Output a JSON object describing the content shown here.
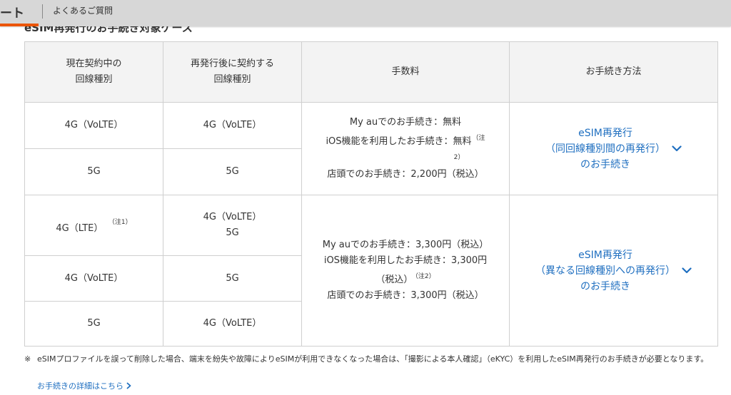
{
  "header": {
    "brand_fragment": "ート",
    "faq_link": "よくあるご質問"
  },
  "section_title": "eSIM再発行のお手続き対象ケース",
  "table": {
    "headers": {
      "current_line": [
        "現在契約中の",
        "回線種別"
      ],
      "after_line": [
        "再発行後に契約する",
        "回線種別"
      ],
      "fee": "手数料",
      "procedure": "お手続き方法"
    },
    "group1": {
      "rows": [
        {
          "current": "4G（VoLTE）",
          "after": "4G（VoLTE）"
        },
        {
          "current": "5G",
          "after": "5G"
        }
      ],
      "fee": {
        "line1": "My auでのお手続き：無料",
        "line2": "iOS機能を利用したお手続き：無料",
        "line2_note_a": "（注",
        "line2_note_b": "2）",
        "line3": "店頭でのお手続き：2,200円（税込）"
      },
      "procedure": {
        "line1": "eSIM再発行",
        "line2": "（同回線種別間の再発行）",
        "line3": "のお手続き"
      }
    },
    "group2": {
      "rows": [
        {
          "current": "4G（LTE）",
          "current_note": "（注1）",
          "after_line1": "4G（VoLTE）",
          "after_line2": "5G"
        },
        {
          "current": "4G（VoLTE）",
          "after": "5G"
        },
        {
          "current": "5G",
          "after": "4G（VoLTE）"
        }
      ],
      "fee": {
        "line1": "My auでのお手続き：3,300円（税込）",
        "line2": "iOS機能を利用したお手続き：3,300円",
        "line3": "（税込）",
        "line3_note": "（注2）",
        "line4": "店頭でのお手続き：3,300円（税込）"
      },
      "procedure": {
        "line1": "eSIM再発行",
        "line2": "（異なる回線種別への再発行）",
        "line3": "のお手続き"
      }
    }
  },
  "note": {
    "mark": "※",
    "text": "eSIMプロファイルを誤って削除した場合、端末を紛失や故障によりeSIMが利用できなくなった場合は、「撮影による本人確認」（eKYC）を利用したeSIM再発行のお手続きが必要となります。"
  },
  "detail_link": "お手続きの詳細はこちら",
  "colors": {
    "accent": "#eb5505",
    "link": "#1f6fc0",
    "header_bg": "#f3f3f3",
    "border": "#cfcfcf"
  }
}
